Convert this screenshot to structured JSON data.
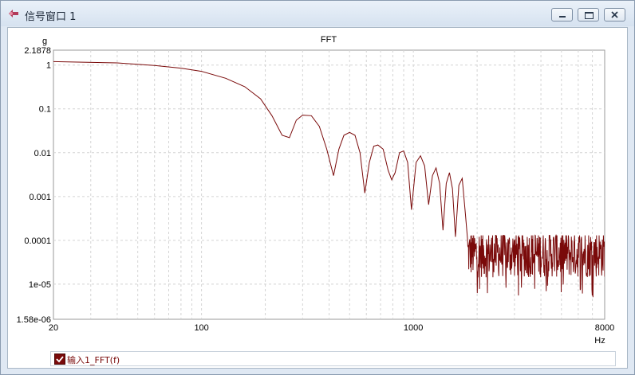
{
  "window": {
    "title": "信号窗口 1"
  },
  "legend": {
    "label": "输入1_FFT(f)",
    "checked": true
  },
  "chart_data": {
    "type": "line",
    "title": "FFT",
    "xlabel": "Hz",
    "ylabel": "g",
    "xscale": "log",
    "yscale": "log",
    "xlim": [
      20,
      8000
    ],
    "ylim": [
      1.58e-06,
      2.1878
    ],
    "xticks": [
      "20",
      "100",
      "1000",
      "8000"
    ],
    "yticks": [
      "2.1878",
      "1",
      "0.1",
      "0.01",
      "0.001",
      "0.0001",
      "1e-05",
      "1.58e-06"
    ],
    "grid": true,
    "color": "#7a0a0a",
    "series": [
      {
        "x": [
          20,
          40,
          60,
          80,
          100,
          130,
          160,
          190,
          215,
          240,
          260,
          280,
          300,
          330,
          360,
          390,
          420,
          445,
          470,
          500,
          530,
          560,
          590,
          620,
          650,
          680,
          720,
          760,
          790,
          820,
          860,
          900,
          940,
          980,
          1030,
          1080,
          1130,
          1180,
          1230,
          1280,
          1330,
          1380,
          1430,
          1480,
          1530,
          1580,
          1640,
          1700,
          1760,
          1800
        ],
        "values": [
          1.2,
          1.12,
          0.98,
          0.85,
          0.72,
          0.5,
          0.32,
          0.17,
          0.07,
          0.025,
          0.022,
          0.055,
          0.072,
          0.07,
          0.04,
          0.012,
          0.003,
          0.012,
          0.025,
          0.029,
          0.025,
          0.01,
          0.0012,
          0.006,
          0.014,
          0.015,
          0.012,
          0.004,
          0.0024,
          0.0035,
          0.01,
          0.011,
          0.006,
          0.0005,
          0.006,
          0.0085,
          0.005,
          0.00065,
          0.003,
          0.0045,
          0.002,
          0.00017,
          0.002,
          0.0035,
          0.0015,
          0.00012,
          0.0018,
          0.0026,
          0.0004,
          0.00011
        ]
      }
    ],
    "noise_floor": {
      "x_range": [
        1800,
        8000
      ],
      "level": 5e-05,
      "min": 5e-06,
      "max": 0.00013
    }
  }
}
